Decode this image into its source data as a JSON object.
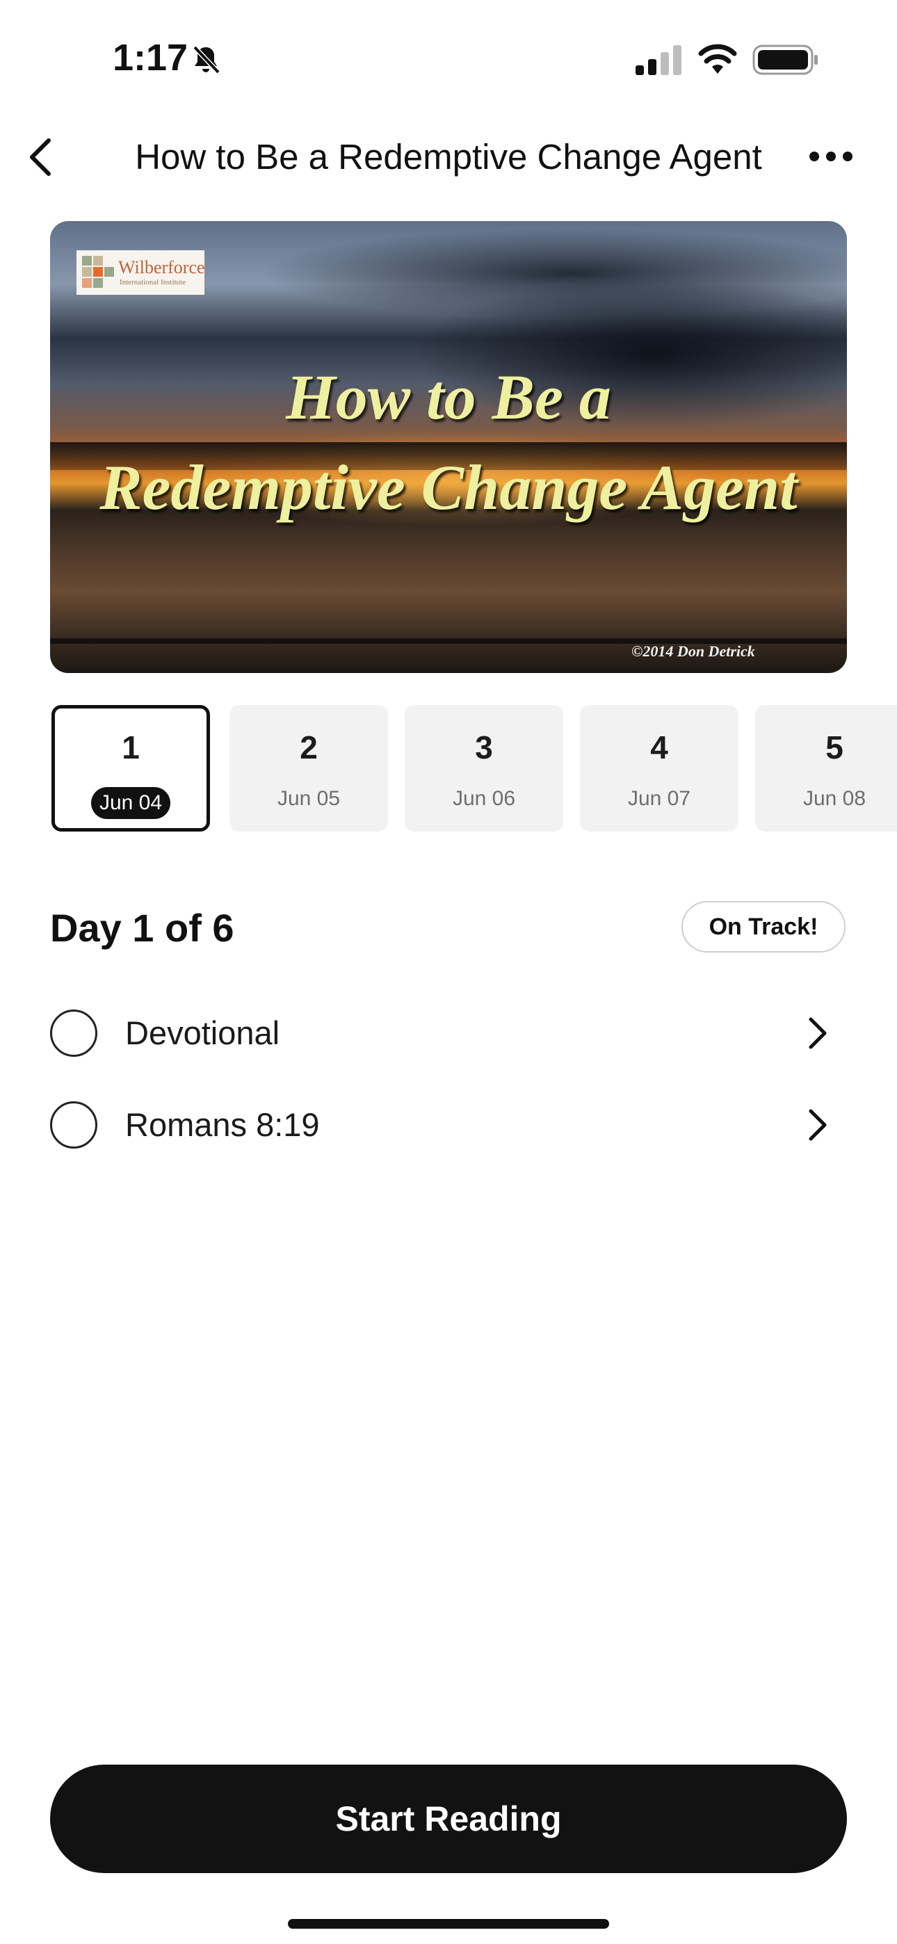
{
  "status_bar": {
    "time": "1:17",
    "icons": [
      "bell-slash-icon",
      "cellular-signal-icon",
      "wifi-icon",
      "battery-icon"
    ]
  },
  "nav": {
    "title": "How to Be a Redemptive Change Agent",
    "back_icon": "chevron-left-icon",
    "more_icon": "ellipsis-icon"
  },
  "hero": {
    "logo_name": "Wilberforce",
    "logo_sub": "International Institute",
    "title_line1": "How to Be a",
    "title_line2": "Redemptive Change Agent",
    "copyright": "©2014 Don Detrick"
  },
  "days": [
    {
      "number": "1",
      "date": "Jun 04",
      "selected": true
    },
    {
      "number": "2",
      "date": "Jun 05",
      "selected": false
    },
    {
      "number": "3",
      "date": "Jun 06",
      "selected": false
    },
    {
      "number": "4",
      "date": "Jun 07",
      "selected": false
    },
    {
      "number": "5",
      "date": "Jun 08",
      "selected": false
    }
  ],
  "day_heading": "Day 1 of 6",
  "status_badge": "On Track!",
  "tasks": [
    {
      "label": "Devotional",
      "completed": false
    },
    {
      "label": "Romans 8:19",
      "completed": false
    }
  ],
  "start_button": "Start Reading",
  "colors": {
    "accent": "#111111",
    "card_bg": "#f2f2f2",
    "muted_text": "#6e6e6e",
    "hero_title": "#eef0a0"
  }
}
